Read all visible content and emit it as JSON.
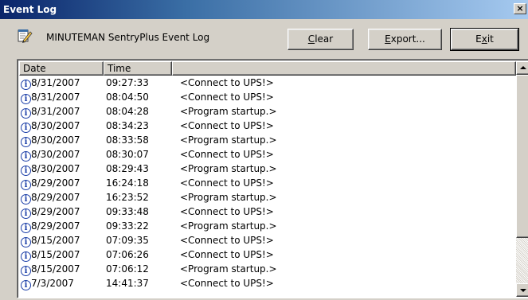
{
  "window": {
    "title": "Event Log",
    "close_label": "×"
  },
  "toolbar": {
    "app_label": "MINUTEMAN SentryPlus Event Log",
    "clear": {
      "mnemonic": "C",
      "rest": "lear"
    },
    "export": {
      "mnemonic": "E",
      "rest": "xport..."
    },
    "exit": {
      "pre": "E",
      "mnemonic": "x",
      "rest": "it"
    }
  },
  "columns": [
    "Date",
    "Time",
    ""
  ],
  "rows": [
    {
      "date": "8/31/2007",
      "time": "09:27:33",
      "event": "<Connect to UPS!>"
    },
    {
      "date": "8/31/2007",
      "time": "08:04:50",
      "event": "<Connect to UPS!>"
    },
    {
      "date": "8/31/2007",
      "time": "08:04:28",
      "event": "<Program startup.>"
    },
    {
      "date": "8/30/2007",
      "time": "08:34:23",
      "event": "<Connect to UPS!>"
    },
    {
      "date": "8/30/2007",
      "time": "08:33:58",
      "event": "<Program startup.>"
    },
    {
      "date": "8/30/2007",
      "time": "08:30:07",
      "event": "<Connect to UPS!>"
    },
    {
      "date": "8/30/2007",
      "time": "08:29:43",
      "event": "<Program startup.>"
    },
    {
      "date": "8/29/2007",
      "time": "16:24:18",
      "event": "<Connect to UPS!>"
    },
    {
      "date": "8/29/2007",
      "time": "16:23:52",
      "event": "<Program startup.>"
    },
    {
      "date": "8/29/2007",
      "time": "09:33:48",
      "event": "<Connect to UPS!>"
    },
    {
      "date": "8/29/2007",
      "time": "09:33:22",
      "event": "<Program startup.>"
    },
    {
      "date": "8/15/2007",
      "time": "07:09:35",
      "event": "<Connect to UPS!>"
    },
    {
      "date": "8/15/2007",
      "time": "07:06:26",
      "event": "<Connect to UPS!>"
    },
    {
      "date": "8/15/2007",
      "time": "07:06:12",
      "event": "<Program startup.>"
    },
    {
      "date": "7/3/2007",
      "time": "14:41:37",
      "event": "<Connect to UPS!>"
    }
  ],
  "icons": {
    "row_icon": "info-icon",
    "app_icon": "notepad-pencil-icon"
  },
  "colors": {
    "titlebar_start": "#0a246a",
    "titlebar_end": "#a6caf0",
    "info_blue": "#1c3fa8"
  }
}
